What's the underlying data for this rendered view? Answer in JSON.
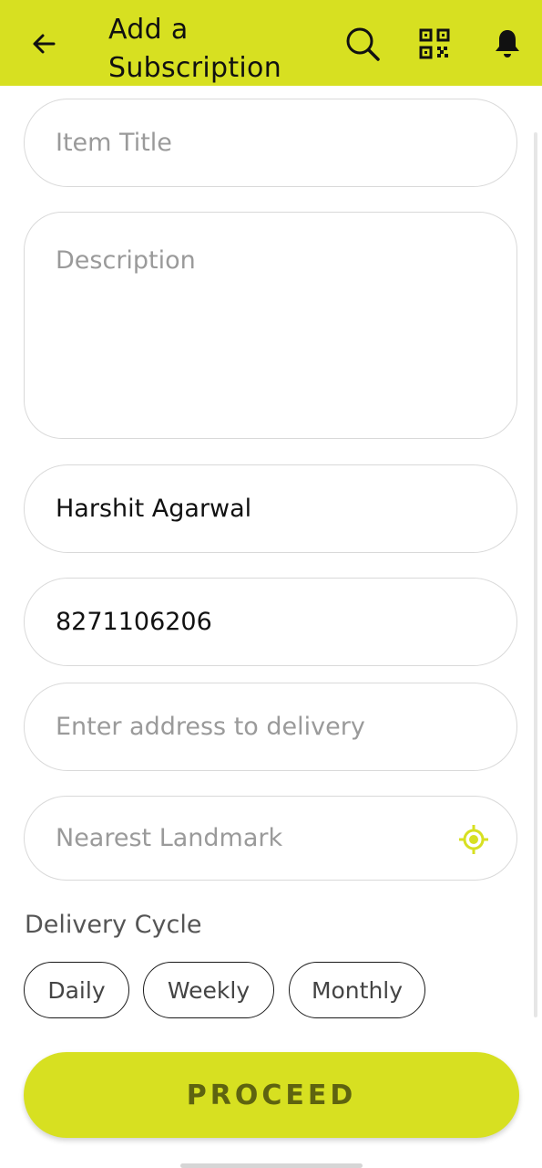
{
  "header": {
    "title": "Add a Subscription",
    "back_icon": "arrow-left-icon",
    "actions": [
      {
        "name": "search",
        "icon": "search-icon"
      },
      {
        "name": "qr",
        "icon": "qr-code-icon"
      },
      {
        "name": "notifications",
        "icon": "bell-icon"
      }
    ]
  },
  "form": {
    "item_title": {
      "placeholder": "Item Title",
      "value": ""
    },
    "description": {
      "placeholder": "Description",
      "value": ""
    },
    "name": {
      "placeholder": "",
      "value": "Harshit Agarwal"
    },
    "phone": {
      "placeholder": "",
      "value": "8271106206"
    },
    "address": {
      "placeholder": "Enter address to delivery",
      "value": ""
    },
    "landmark": {
      "placeholder": "Nearest Landmark",
      "value": "",
      "icon": "location-target-icon"
    }
  },
  "delivery_cycle": {
    "label": "Delivery Cycle",
    "options": [
      "Daily",
      "Weekly",
      "Monthly"
    ]
  },
  "proceed_button": {
    "label": "PROCEED"
  },
  "colors": {
    "accent": "#d7e021",
    "proceed_text": "#5e6310",
    "border": "#d9d9d9",
    "placeholder": "#9a9a9a"
  }
}
